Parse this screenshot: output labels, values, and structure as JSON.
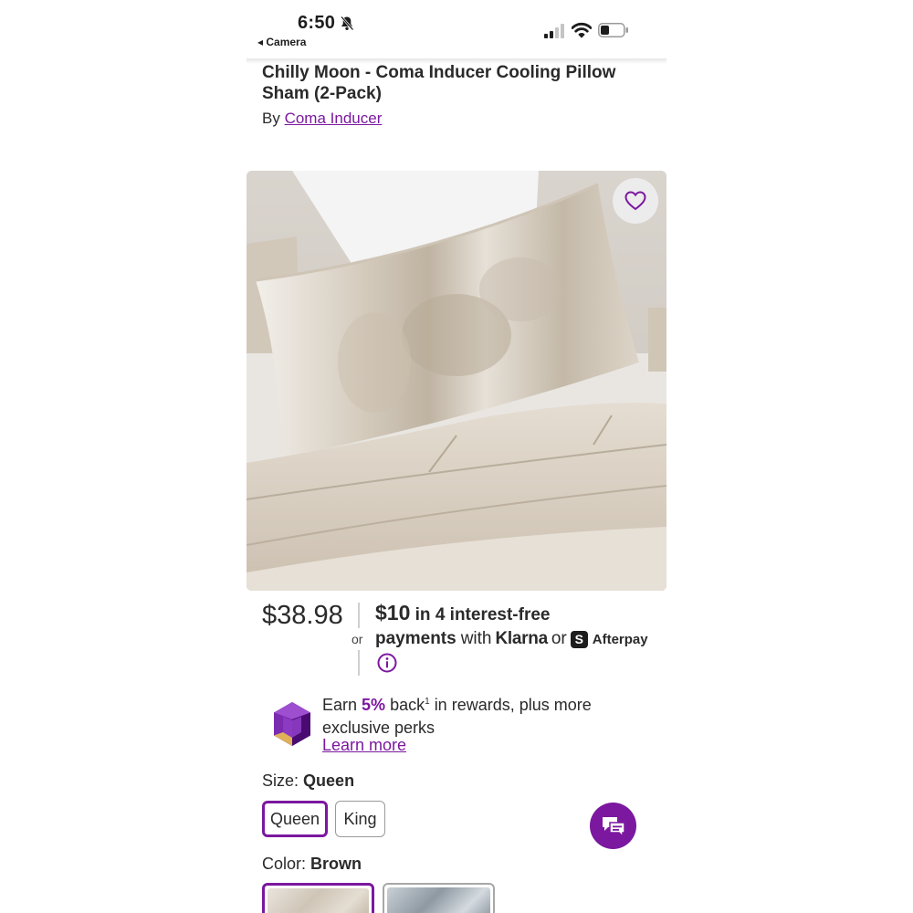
{
  "status_bar": {
    "time": "6:50",
    "back_app": "◂ Camera",
    "icons": [
      "bell-muted-icon",
      "cell-signal-icon",
      "wifi-icon",
      "battery-icon"
    ]
  },
  "product": {
    "title": "Chilly Moon - Coma Inducer Cooling Pillow Sham (2-Pack)",
    "by_prefix": "By",
    "brand": "Coma Inducer",
    "image_alt": "Tie-dye cooling pillow sham on bed"
  },
  "price": {
    "amount": "$38.98",
    "or": "or",
    "installment_amount": "$10",
    "installment_rest": "in 4 interest-free",
    "payments_label": "payments",
    "with_label": "with",
    "klarna": "Klarna",
    "or_label": "or",
    "afterpay_glyph": "S",
    "afterpay": "Afterpay"
  },
  "rewards": {
    "earn": "Earn",
    "percent": "5%",
    "back": "back",
    "footnote": "1",
    "rest": "in rewards, plus more exclusive perks",
    "learn_more": "Learn more"
  },
  "size": {
    "label": "Size:",
    "selected": "Queen",
    "options": [
      "Queen",
      "King"
    ]
  },
  "color": {
    "label": "Color:",
    "selected": "Brown",
    "options": [
      "Brown",
      "Grey"
    ]
  },
  "theme": {
    "accent": "#7b189f",
    "text": "#2a2a2a"
  }
}
